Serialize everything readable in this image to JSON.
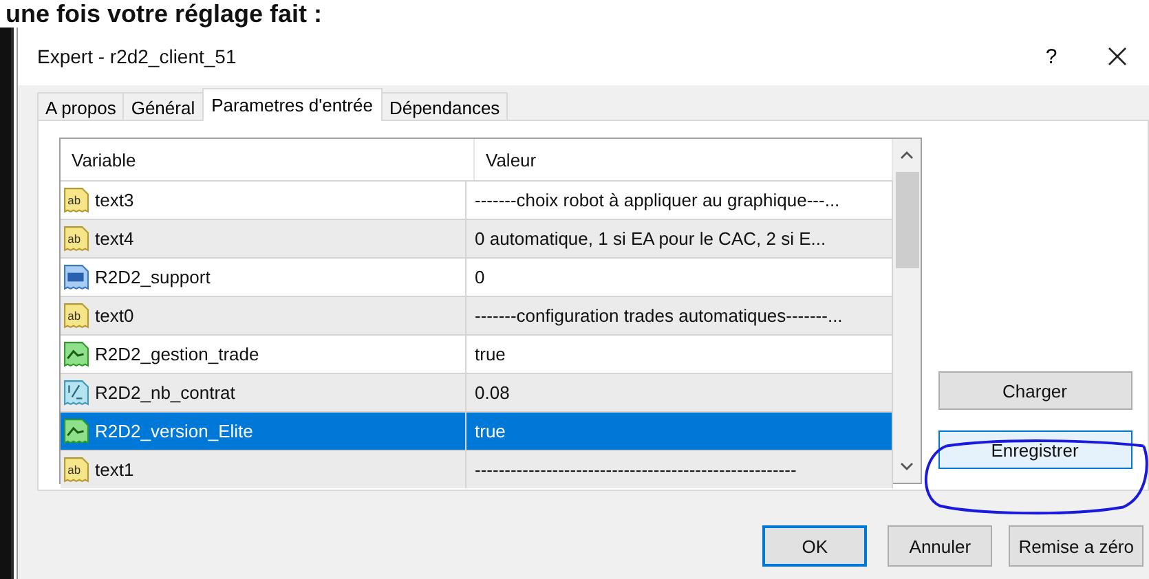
{
  "heading": "une fois votre réglage fait :",
  "window": {
    "title": "Expert - r2d2_client_51",
    "help": "?"
  },
  "tabs": [
    {
      "label": "A propos",
      "selected": false
    },
    {
      "label": "Général",
      "selected": false
    },
    {
      "label": "Parametres d'entrée",
      "selected": true
    },
    {
      "label": "Dépendances",
      "selected": false
    }
  ],
  "table": {
    "columns": [
      "Variable",
      "Valeur"
    ],
    "rows": [
      {
        "kind": "text",
        "icon_label": "ab",
        "variable": "text3",
        "value": "-------choix robot à appliquer au graphique---...",
        "selected": false
      },
      {
        "kind": "text",
        "icon_label": "ab",
        "variable": "text4",
        "value": "0 automatique, 1 si EA pour le CAC, 2 si E...",
        "selected": false
      },
      {
        "kind": "integer",
        "variable": "R2D2_support",
        "value": "0",
        "selected": false
      },
      {
        "kind": "text",
        "icon_label": "ab",
        "variable": "text0",
        "value": "-------configuration trades automatiques-------...",
        "selected": false
      },
      {
        "kind": "boolean",
        "variable": "R2D2_gestion_trade",
        "value": "true",
        "selected": false
      },
      {
        "kind": "decimal",
        "variable": "R2D2_nb_contrat",
        "value": "0.08",
        "selected": false
      },
      {
        "kind": "boolean",
        "variable": "R2D2_version_Elite",
        "value": "true",
        "selected": true
      },
      {
        "kind": "text",
        "icon_label": "ab",
        "variable": "text1",
        "value": "------------------------------------------------------",
        "selected": false
      }
    ]
  },
  "side_buttons": [
    {
      "label": "Charger",
      "focused": false
    },
    {
      "label": "Enregistrer",
      "focused": true
    }
  ],
  "buttons": [
    {
      "label": "OK",
      "default": true
    },
    {
      "label": "Annuler",
      "default": false
    },
    {
      "label": "Remise a zéro",
      "default": false
    }
  ]
}
